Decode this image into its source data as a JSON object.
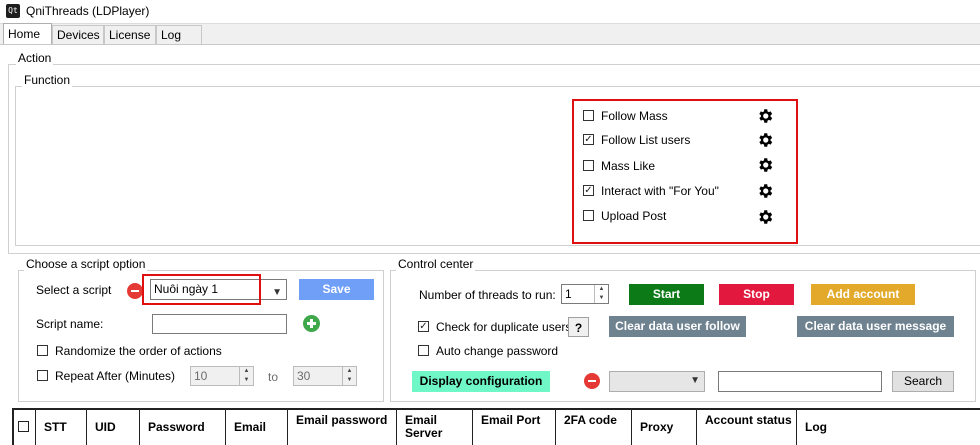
{
  "window": {
    "title": "QniThreads (LDPlayer)",
    "icon_text": "Qt"
  },
  "tabs": [
    {
      "label": "Home",
      "active": true
    },
    {
      "label": "Devices"
    },
    {
      "label": "License"
    },
    {
      "label": "Log"
    }
  ],
  "action": {
    "legend": "Action"
  },
  "function": {
    "legend": "Function",
    "items": [
      {
        "label": "Follow Mass",
        "checked": false
      },
      {
        "label": "Follow List users",
        "checked": true
      },
      {
        "label": "Mass Like",
        "checked": false
      },
      {
        "label": "Interact with \"For You\"",
        "checked": true
      },
      {
        "label": "Upload Post",
        "checked": false
      }
    ]
  },
  "script": {
    "legend": "Choose a script option",
    "select_label": "Select a script",
    "selected": "Nuôi ngày 1",
    "save_label": "Save",
    "name_label": "Script name:",
    "name_value": "",
    "randomize_label": "Randomize the order of actions",
    "repeat_label": "Repeat After (Minutes)",
    "repeat_from": "10",
    "to_label": "to",
    "repeat_to": "30"
  },
  "control": {
    "legend": "Control center",
    "threads_label": "Number of threads to run:",
    "threads_value": "1",
    "start_label": "Start",
    "stop_label": "Stop",
    "add_account_label": "Add account",
    "dup_label": "Check for duplicate users",
    "dup_checked": true,
    "help_label": "?",
    "clear_follow_label": "Clear data user follow",
    "clear_message_label": "Clear data user message",
    "auto_pwd_label": "Auto change password",
    "display_config_label": "Display configuration",
    "search_value": "",
    "search_label": "Search",
    "colors": {
      "start": "#0b7a17",
      "stop": "#e3183f",
      "add": "#e3a92a",
      "clear": "#6f8290",
      "display": "#6ff7c7",
      "save": "#6f9ff7"
    }
  },
  "grid": {
    "columns": [
      "",
      "STT",
      "UID",
      "Password",
      "Email",
      "Email password",
      "Email Server",
      "Email Port",
      "2FA code",
      "Proxy",
      "Account status",
      "Log"
    ]
  }
}
